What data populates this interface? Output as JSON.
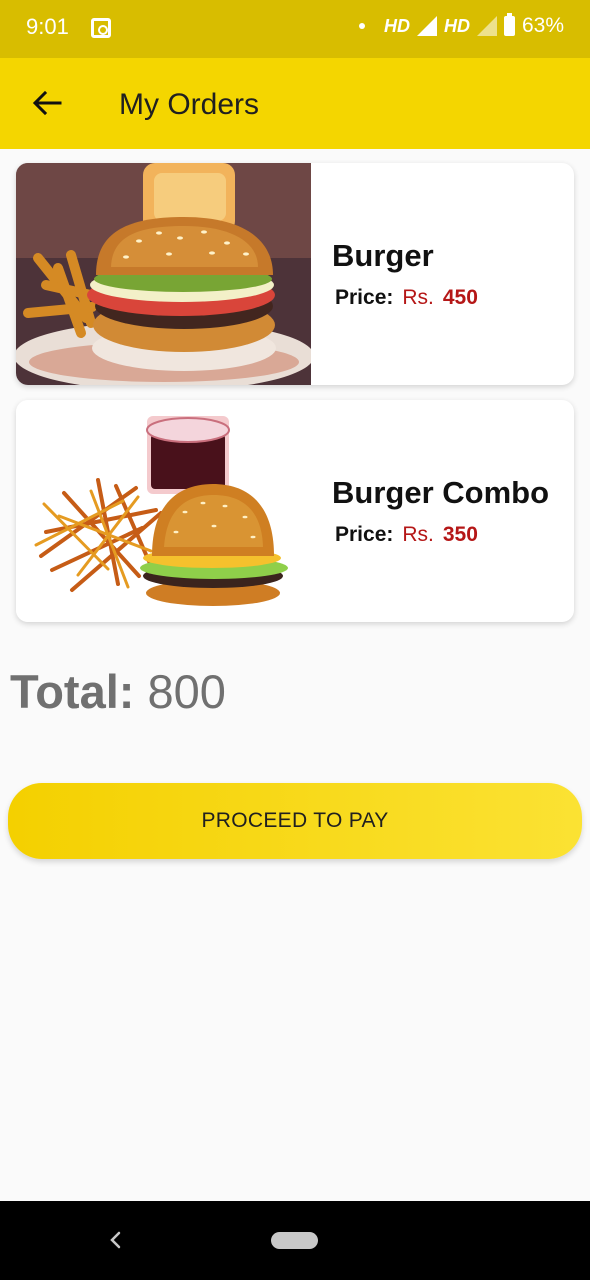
{
  "status_bar": {
    "time": "9:01",
    "network_1": "HD",
    "network_2": "HD",
    "battery": "63%"
  },
  "app_bar": {
    "title": "My Orders",
    "back_icon": "arrow-left-icon"
  },
  "orders": [
    {
      "name": "Burger",
      "price_label": "Price:",
      "currency": "Rs.",
      "price": "450"
    },
    {
      "name": "Burger Combo",
      "price_label": "Price:",
      "currency": "Rs.",
      "price": "350"
    }
  ],
  "total": {
    "label": "Total:",
    "value": "800"
  },
  "actions": {
    "proceed_label": "PROCEED TO PAY"
  },
  "colors": {
    "app_bar": "#f4d600",
    "status_bar": "#d8bd00",
    "price": "#b51717",
    "button": "#f4d000"
  }
}
